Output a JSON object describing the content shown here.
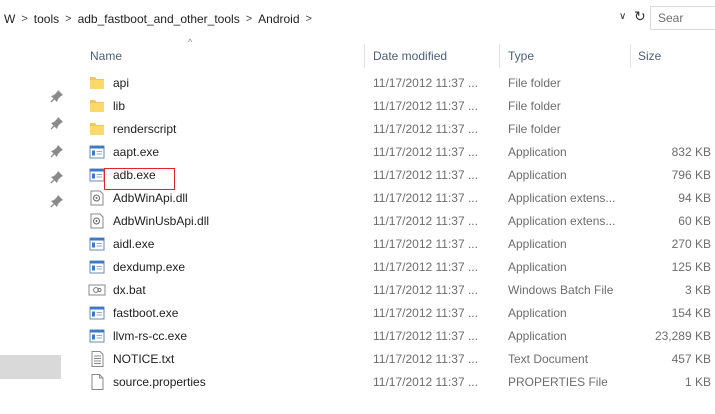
{
  "address": {
    "crumbs": [
      "W",
      "tools",
      "adb_fastboot_and_other_tools",
      "Android"
    ],
    "search_placeholder": "Sear"
  },
  "columns": {
    "name": "Name",
    "date": "Date modified",
    "type": "Type",
    "size": "Size"
  },
  "files": [
    {
      "name": "api",
      "date": "11/17/2012 11:37 ...",
      "type": "File folder",
      "size": "",
      "icon": "folder-icon"
    },
    {
      "name": "lib",
      "date": "11/17/2012 11:37 ...",
      "type": "File folder",
      "size": "",
      "icon": "folder-icon"
    },
    {
      "name": "renderscript",
      "date": "11/17/2012 11:37 ...",
      "type": "File folder",
      "size": "",
      "icon": "folder-icon"
    },
    {
      "name": "aapt.exe",
      "date": "11/17/2012 11:37 ...",
      "type": "Application",
      "size": "832 KB",
      "icon": "application-icon"
    },
    {
      "name": "adb.exe",
      "date": "11/17/2012 11:37 ...",
      "type": "Application",
      "size": "796 KB",
      "icon": "application-icon"
    },
    {
      "name": "AdbWinApi.dll",
      "date": "11/17/2012 11:37 ...",
      "type": "Application extens...",
      "size": "94 KB",
      "icon": "dll-icon"
    },
    {
      "name": "AdbWinUsbApi.dll",
      "date": "11/17/2012 11:37 ...",
      "type": "Application extens...",
      "size": "60 KB",
      "icon": "dll-icon"
    },
    {
      "name": "aidl.exe",
      "date": "11/17/2012 11:37 ...",
      "type": "Application",
      "size": "270 KB",
      "icon": "application-icon"
    },
    {
      "name": "dexdump.exe",
      "date": "11/17/2012 11:37 ...",
      "type": "Application",
      "size": "125 KB",
      "icon": "application-icon"
    },
    {
      "name": "dx.bat",
      "date": "11/17/2012 11:37 ...",
      "type": "Windows Batch File",
      "size": "3 KB",
      "icon": "batch-file-icon"
    },
    {
      "name": "fastboot.exe",
      "date": "11/17/2012 11:37 ...",
      "type": "Application",
      "size": "154 KB",
      "icon": "application-icon"
    },
    {
      "name": "llvm-rs-cc.exe",
      "date": "11/17/2012 11:37 ...",
      "type": "Application",
      "size": "23,289 KB",
      "icon": "application-icon"
    },
    {
      "name": "NOTICE.txt",
      "date": "11/17/2012 11:37 ...",
      "type": "Text Document",
      "size": "457 KB",
      "icon": "text-document-icon"
    },
    {
      "name": "source.properties",
      "date": "11/17/2012 11:37 ...",
      "type": "PROPERTIES File",
      "size": "1 KB",
      "icon": "blank-file-icon"
    }
  ],
  "highlighted_file": "adb.exe",
  "colors": {
    "highlight_border": "#e0242b",
    "folder": "#f2c55c",
    "header_text": "#4c607a"
  }
}
